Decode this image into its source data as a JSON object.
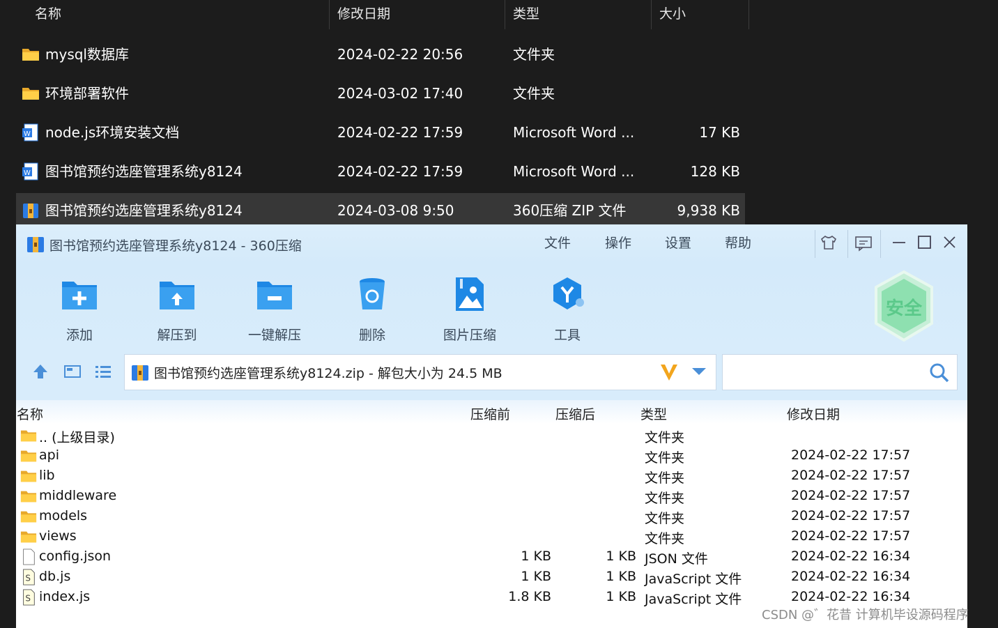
{
  "explorer": {
    "headers": {
      "name": "名称",
      "modified": "修改日期",
      "type": "类型",
      "size": "大小"
    },
    "rows": [
      {
        "icon": "folder-icon",
        "name": "mysql数据库",
        "modified": "2024-02-22 20:56",
        "type": "文件夹",
        "size": ""
      },
      {
        "icon": "folder-icon",
        "name": "环境部署软件",
        "modified": "2024-03-02 17:40",
        "type": "文件夹",
        "size": ""
      },
      {
        "icon": "word-document-icon",
        "name": "node.js环境安装文档",
        "modified": "2024-02-22 17:59",
        "type": "Microsoft Word ...",
        "size": "17 KB"
      },
      {
        "icon": "word-document-icon",
        "name": "图书馆预约选座管理系统y8124",
        "modified": "2024-02-22 17:59",
        "type": "Microsoft Word ...",
        "size": "128 KB"
      },
      {
        "icon": "zip-archive-icon",
        "name": "图书馆预约选座管理系统y8124",
        "modified": "2024-03-08 9:50",
        "type": "360压缩 ZIP 文件",
        "size": "9,938 KB",
        "selected": true
      }
    ]
  },
  "zip": {
    "title": "图书馆预约选座管理系统y8124 - 360压缩",
    "menu": [
      "文件",
      "操作",
      "设置",
      "帮助"
    ],
    "tools": [
      "添加",
      "解压到",
      "一键解压",
      "删除",
      "图片压缩",
      "工具"
    ],
    "badge": "安全",
    "address": "图书馆预约选座管理系统y8124.zip - 解包大小为 24.5 MB",
    "search_value": "",
    "columns": {
      "name": "名称",
      "before": "压缩前",
      "after": "压缩后",
      "type": "类型",
      "modified": "修改日期"
    },
    "files": [
      {
        "icon": "folder-icon",
        "name": ".. (上级目录)",
        "before": "",
        "after": "",
        "type": "文件夹",
        "modified": ""
      },
      {
        "icon": "folder-icon",
        "name": "api",
        "before": "",
        "after": "",
        "type": "文件夹",
        "modified": "2024-02-22 17:57"
      },
      {
        "icon": "folder-icon",
        "name": "lib",
        "before": "",
        "after": "",
        "type": "文件夹",
        "modified": "2024-02-22 17:57"
      },
      {
        "icon": "folder-icon",
        "name": "middleware",
        "before": "",
        "after": "",
        "type": "文件夹",
        "modified": "2024-02-22 17:57"
      },
      {
        "icon": "folder-icon",
        "name": "models",
        "before": "",
        "after": "",
        "type": "文件夹",
        "modified": "2024-02-22 17:57"
      },
      {
        "icon": "folder-icon",
        "name": "views",
        "before": "",
        "after": "",
        "type": "文件夹",
        "modified": "2024-02-22 17:57"
      },
      {
        "icon": "json-file-icon",
        "name": "config.json",
        "before": "1 KB",
        "after": "1 KB",
        "type": "JSON 文件",
        "modified": "2024-02-22 16:34"
      },
      {
        "icon": "javascript-file-icon",
        "name": "db.js",
        "before": "1 KB",
        "after": "1 KB",
        "type": "JavaScript 文件",
        "modified": "2024-02-22 16:34"
      },
      {
        "icon": "javascript-file-icon",
        "name": "index.js",
        "before": "1.8 KB",
        "after": "1 KB",
        "type": "JavaScript 文件",
        "modified": "2024-02-22 16:34"
      }
    ]
  },
  "watermark": "CSDN @゛花昔  计算机毕设源码程序",
  "colors": {
    "accent": "#1e88e5",
    "safe_green": "#5bc98a",
    "titlebar": "#d4eafa"
  }
}
